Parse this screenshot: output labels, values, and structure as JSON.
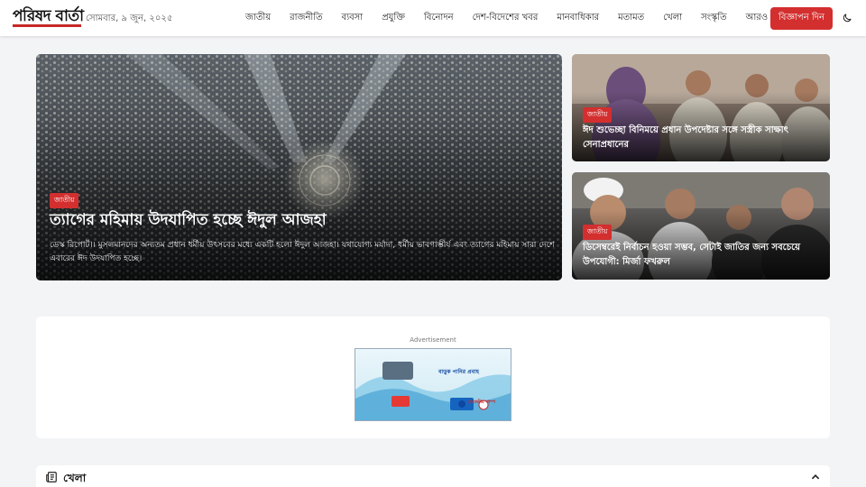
{
  "header": {
    "logo_text": "পরিষদ বার্তা",
    "date": "সোমবার, ৯ জুন, ২০২৫",
    "nav": [
      "জাতীয়",
      "রাজনীতি",
      "ব্যবসা",
      "প্রযুক্তি",
      "বিনোদন",
      "দেশ-বিদেশের খবর",
      "মানবাধিকার",
      "মতামত",
      "খেলা",
      "সংস্কৃতি"
    ],
    "more_label": "আরও",
    "ad_button": "বিজ্ঞাপন দিন",
    "theme_icon": "moon-icon"
  },
  "lead": {
    "badge": "জাতীয়",
    "title": "ত্যাগের মহিমায় উদযাপিত হচ্ছে ঈদুল আজহা",
    "excerpt": "ডেস্ক রিপোর্ট।। মুসলমানদের অন্যতম প্রধান ধর্মীয় উৎসবের মধ্যে একটি হলো ঈদুল আজহা। যথাযোগ্য মর্যাদা, ধর্মীয় ভাবগাম্ভীর্য এবং ত্যাগের মহিমায় সারা দেশে এবারের ঈদ উদযাপিত হচ্ছে।"
  },
  "side_stories": [
    {
      "badge": "জাতীয়",
      "title": "ঈদ শুভেচ্ছা বিনিময়ে প্রধান উপদেষ্টার সঙ্গে সস্ত্রীক সাক্ষাৎ সেনাপ্রধানের"
    },
    {
      "badge": "জাতীয়",
      "title": "ডিসেম্বরেই নির্বাচন হওয়া সম্ভব, সেটাই জাতির জন্য সবচেয়ে উপযোগী: মির্জা ফখরুল"
    }
  ],
  "advertisement": {
    "label": "Advertisement",
    "banner_headline": "বাড়ুক পানির প্রবাহ",
    "banner_brand": "গেজেটার পাম্প"
  },
  "section": {
    "title": "খেলা",
    "icon": "newspaper-icon",
    "toggle_icon": "chevron-up-icon"
  },
  "colors": {
    "accent": "#d32f2f",
    "background": "#f3f4f6"
  }
}
